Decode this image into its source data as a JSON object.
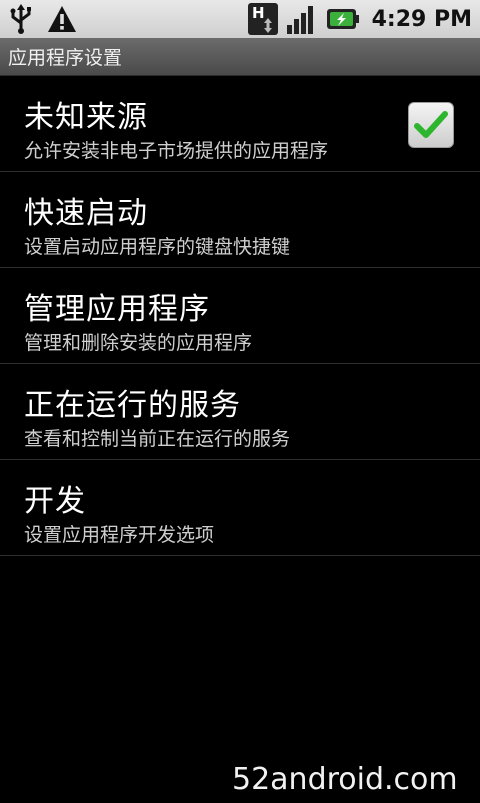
{
  "status_bar": {
    "time": "4:29 PM",
    "icons": [
      "usb-icon",
      "warning-icon",
      "hspa-data-icon",
      "signal-icon",
      "battery-charging-icon"
    ],
    "network_type_letter": "H"
  },
  "title_bar": {
    "title": "应用程序设置"
  },
  "settings": [
    {
      "title": "未知来源",
      "summary": "允许安装非电子市场提供的应用程序",
      "checked": true
    },
    {
      "title": "快速启动",
      "summary": "设置启动应用程序的键盘快捷键"
    },
    {
      "title": "管理应用程序",
      "summary": "管理和删除安装的应用程序"
    },
    {
      "title": "正在运行的服务",
      "summary": "查看和控制当前正在运行的服务"
    },
    {
      "title": "开发",
      "summary": "设置应用程序开发选项"
    }
  ],
  "watermark": "52android.com",
  "colors": {
    "checkmark": "#2db52d",
    "battery": "#3bb03b"
  }
}
